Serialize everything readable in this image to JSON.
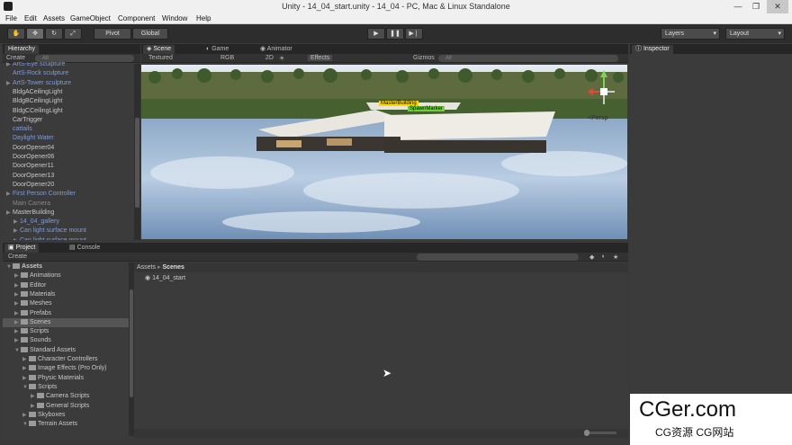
{
  "window": {
    "title": "Unity - 14_04_start.unity - 14_04 - PC, Mac & Linux Standalone"
  },
  "menu": [
    "File",
    "Edit",
    "Assets",
    "GameObject",
    "Component",
    "Window",
    "Help"
  ],
  "toolbar": {
    "pivot": "Pivot",
    "global": "Global",
    "layers": "Layers",
    "layout": "Layout"
  },
  "hierarchy": {
    "tab": "Hierarchy",
    "create": "Create",
    "search": "All",
    "items": [
      {
        "label": "ArtS-Eye sculpture",
        "color": "blue",
        "arrow": true
      },
      {
        "label": "ArtS-Rock sculpture",
        "color": "blue",
        "arrow": false
      },
      {
        "label": "ArtS-Tower sculpture",
        "color": "blue",
        "arrow": true
      },
      {
        "label": "BldgACeilingLight",
        "color": "normal",
        "arrow": false
      },
      {
        "label": "BldgBCeilingLight",
        "color": "normal",
        "arrow": false
      },
      {
        "label": "BldgCCeilingLight",
        "color": "normal",
        "arrow": false
      },
      {
        "label": "CarTrigger",
        "color": "normal",
        "arrow": false
      },
      {
        "label": "cattails",
        "color": "blue",
        "arrow": false
      },
      {
        "label": "Daylight Water",
        "color": "blue",
        "arrow": false
      },
      {
        "label": "DoorOpener04",
        "color": "normal",
        "arrow": false
      },
      {
        "label": "DoorOpener06",
        "color": "normal",
        "arrow": false
      },
      {
        "label": "DoorOpener11",
        "color": "normal",
        "arrow": false
      },
      {
        "label": "DoorOpener13",
        "color": "normal",
        "arrow": false
      },
      {
        "label": "DoorOpener20",
        "color": "normal",
        "arrow": false
      },
      {
        "label": "First Person Controller",
        "color": "blue",
        "arrow": true
      },
      {
        "label": "Main Camera",
        "color": "gray",
        "arrow": false
      },
      {
        "label": "MasterBuilding",
        "color": "normal",
        "arrow": true
      },
      {
        "label": "14_04_gallery",
        "color": "blue",
        "arrow": true,
        "indent": 1
      },
      {
        "label": "Can light surface mount",
        "color": "blue",
        "arrow": true,
        "indent": 1
      },
      {
        "label": "Can light surface mount",
        "color": "blue",
        "arrow": true,
        "indent": 1
      }
    ]
  },
  "scene": {
    "tabs": [
      "Scene",
      "Game",
      "Animator"
    ],
    "render_mode": "Textured",
    "color_mode": "RGB",
    "mode_2d": "2D",
    "effects": "Effects",
    "gizmos": "Gizmos",
    "search": "All",
    "persp": "<Persp",
    "labels": [
      "MasterBuilding",
      "SpawnMarker"
    ]
  },
  "inspector": {
    "tab": "Inspector"
  },
  "project": {
    "tabs": [
      "Project",
      "Console"
    ],
    "create": "Create",
    "breadcrumb": [
      "Assets",
      "Scenes"
    ],
    "tree": [
      {
        "label": "Assets",
        "level": 0,
        "open": true,
        "bold": true
      },
      {
        "label": "Animations",
        "level": 1,
        "open": false
      },
      {
        "label": "Editor",
        "level": 1,
        "open": false
      },
      {
        "label": "Materials",
        "level": 1,
        "open": false
      },
      {
        "label": "Meshes",
        "level": 1,
        "open": false
      },
      {
        "label": "Prefabs",
        "level": 1,
        "open": false
      },
      {
        "label": "Scenes",
        "level": 1,
        "open": false,
        "selected": true
      },
      {
        "label": "Scripts",
        "level": 1,
        "open": false
      },
      {
        "label": "Sounds",
        "level": 1,
        "open": false
      },
      {
        "label": "Standard Assets",
        "level": 1,
        "open": true
      },
      {
        "label": "Character Controllers",
        "level": 2,
        "open": false
      },
      {
        "label": "Image Effects (Pro Only)",
        "level": 2,
        "open": false
      },
      {
        "label": "Physic Materials",
        "level": 2,
        "open": false
      },
      {
        "label": "Scripts",
        "level": 2,
        "open": true
      },
      {
        "label": "Camera Scripts",
        "level": 3,
        "open": false
      },
      {
        "label": "General Scripts",
        "level": 3,
        "open": false
      },
      {
        "label": "Skyboxes",
        "level": 2,
        "open": false
      },
      {
        "label": "Terrain Assets",
        "level": 2,
        "open": true
      }
    ],
    "files": [
      "14_04_start"
    ]
  },
  "watermark": {
    "main": "CGer.com",
    "sub": "CG资源 CG网站"
  },
  "colors": {
    "toolbar": "#2d2d2d",
    "panel": "#3b3b3b",
    "accent_blue": "#7f9cd9",
    "selection": "#555555"
  }
}
